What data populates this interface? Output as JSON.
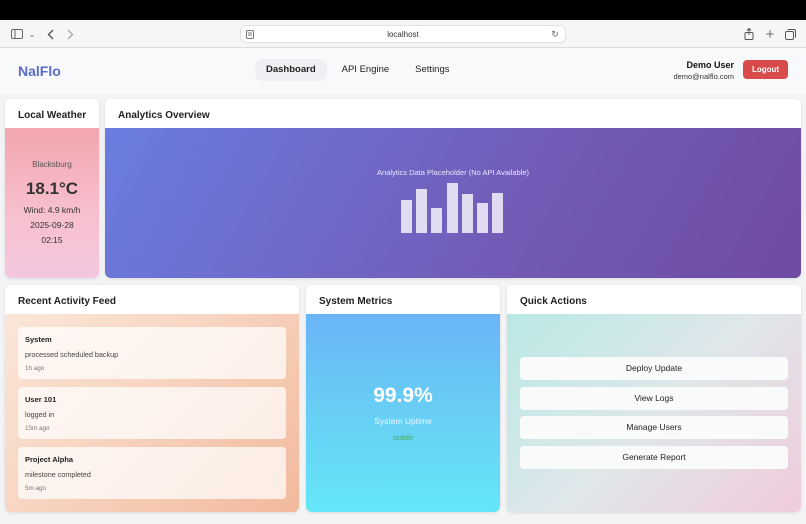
{
  "browser": {
    "url": "localhost"
  },
  "app": {
    "brand": "NalFlo",
    "nav": [
      "Dashboard",
      "API Engine",
      "Settings"
    ],
    "user_name": "Demo User",
    "user_email": "demo@nalflo.com",
    "logout_label": "Logout"
  },
  "weather": {
    "title": "Local Weather",
    "city": "Blacksburg",
    "temperature": "18.1°C",
    "wind": "Wind: 4.9 km/h",
    "date": "2025-09-28",
    "time": "02:15"
  },
  "analytics": {
    "title": "Analytics Overview",
    "placeholder": "Analytics Data Placeholder (No API Available)"
  },
  "activity": {
    "title": "Recent Activity Feed",
    "items": [
      {
        "title": "System",
        "desc": "processed scheduled backup",
        "time": "1h ago"
      },
      {
        "title": "User 101",
        "desc": "logged in",
        "time": "15m ago"
      },
      {
        "title": "Project Alpha",
        "desc": "milestone completed",
        "time": "5m ago"
      }
    ]
  },
  "metrics": {
    "title": "System Metrics",
    "value": "99.9%",
    "label": "System Uptime",
    "status": "stable"
  },
  "quick_actions": {
    "title": "Quick Actions",
    "buttons": [
      "Deploy Update",
      "View Logs",
      "Manage Users",
      "Generate Report"
    ]
  },
  "colors": {
    "brand": "#5a6bc8",
    "logout": "#d94b4b",
    "status_ok": "#4caf50"
  },
  "icons": [
    "sidebar-toggle-icon",
    "chevron-down-icon",
    "back-arrow-icon",
    "forward-arrow-icon",
    "site-icon",
    "reload-icon",
    "share-icon",
    "new-tab-icon",
    "tabs-overview-icon"
  ]
}
